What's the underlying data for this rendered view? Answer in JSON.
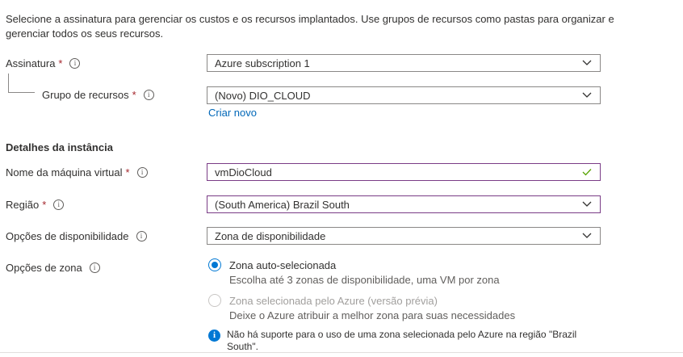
{
  "intro_text": "Selecione a assinatura para gerenciar os custos e os recursos implantados. Use grupos de recursos como pastas para organizar e gerenciar todos os seus recursos.",
  "subscription": {
    "label": "Assinatura",
    "required": "*",
    "value": "Azure subscription 1"
  },
  "resource_group": {
    "label": "Grupo de recursos",
    "required": "*",
    "value": "(Novo) DIO_CLOUD",
    "create_link": "Criar novo"
  },
  "instance_section": {
    "title": "Detalhes da instância"
  },
  "vm_name": {
    "label": "Nome da máquina virtual",
    "required": "*",
    "value": "vmDioCloud"
  },
  "region": {
    "label": "Região",
    "required": "*",
    "value": "(South America) Brazil South"
  },
  "availability": {
    "label": "Opções de disponibilidade",
    "value": "Zona de disponibilidade"
  },
  "zone": {
    "label": "Opções de zona",
    "options": [
      {
        "title": "Zona auto-selecionada",
        "desc": "Escolha até 3 zonas de disponibilidade, uma VM por zona",
        "selected": true,
        "enabled": true
      },
      {
        "title": "Zona selecionada pelo Azure (versão prévia)",
        "desc": "Deixe o Azure atribuir a melhor zona para suas necessidades",
        "selected": false,
        "enabled": false
      }
    ],
    "notice": "Não há suporte para o uso de uma zona selecionada pelo Azure na região \"Brazil South\"."
  },
  "colors": {
    "accent": "#0078d4",
    "required": "#a4262c",
    "valid": "#57a300",
    "active_border": "#7a3c86"
  },
  "icons": {
    "info": "info-icon",
    "chevron": "chevron-down-icon",
    "check": "check-icon",
    "notice": "info-solid-icon"
  }
}
